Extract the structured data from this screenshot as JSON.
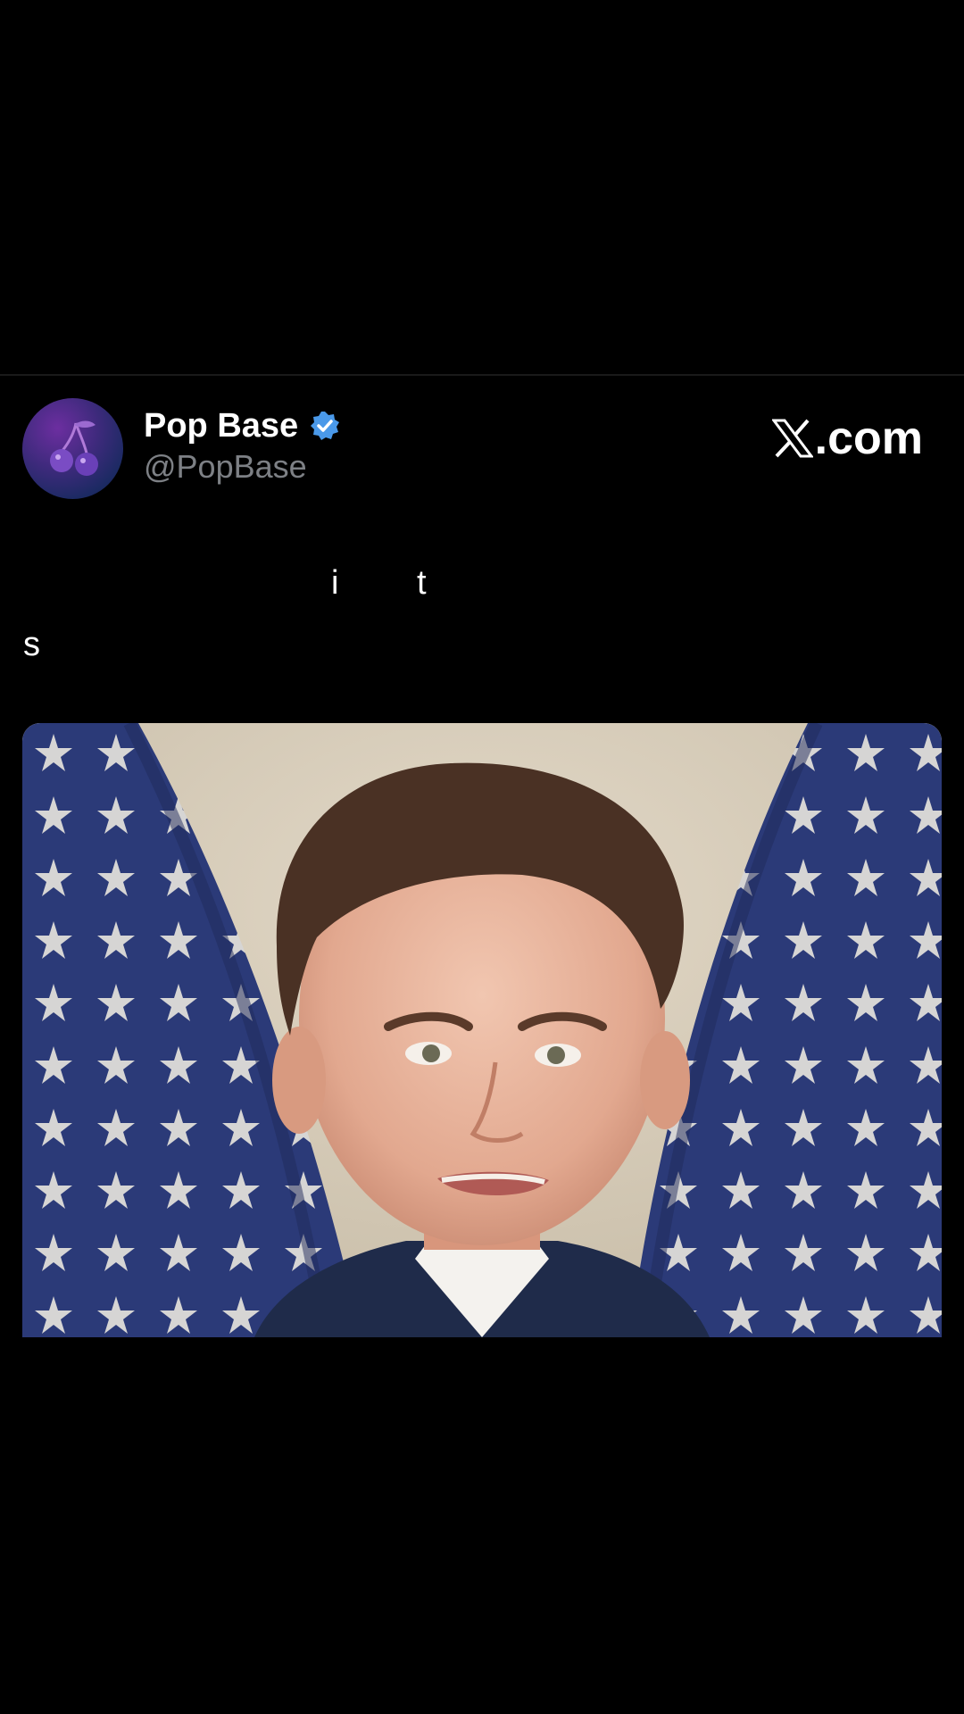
{
  "post": {
    "display_name": "Pop Base",
    "handle": "@PopBase",
    "verified": true,
    "verified_color": "#4a99e9",
    "avatar_icon": "cherry-icon",
    "site_mark": "X",
    "site_text": ".com",
    "caption_fragments": [
      "i",
      "t",
      "s"
    ],
    "media_description_icon": "video-frame"
  },
  "colors": {
    "background": "#000000",
    "handle_text": "#7d8085",
    "divider": "#1a1a1a"
  }
}
